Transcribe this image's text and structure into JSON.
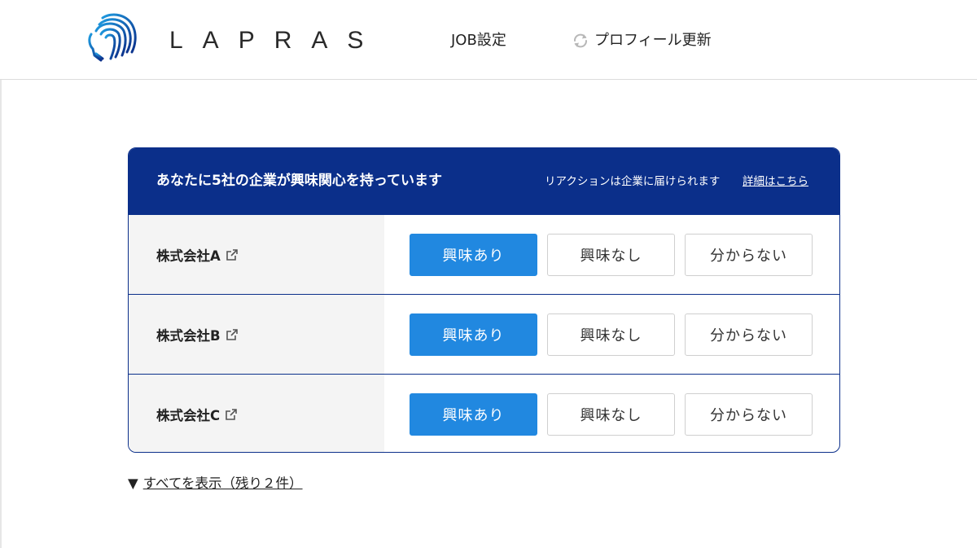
{
  "header": {
    "logo_text": "LAPRAS",
    "nav_job": "JOB設定",
    "nav_refresh": "プロフィール更新",
    "brand_color": "#1a6fc4"
  },
  "card": {
    "title": "あなたに5社の企業が興味関心を持っています",
    "note": "リアクションは企業に届けられます",
    "detail_link": "詳細はこちら",
    "header_color": "#0b2f8a",
    "rows": [
      {
        "company": "株式会社A",
        "selected": "興味あり"
      },
      {
        "company": "株式会社B",
        "selected": "興味あり"
      },
      {
        "company": "株式会社C",
        "selected": "興味あり"
      }
    ],
    "options": {
      "yes": "興味あり",
      "no": "興味なし",
      "unknown": "分からない"
    },
    "selected_color": "#2188e0"
  },
  "show_all": {
    "triangle": "▼",
    "label": "すべてを表示（残り２件）"
  }
}
